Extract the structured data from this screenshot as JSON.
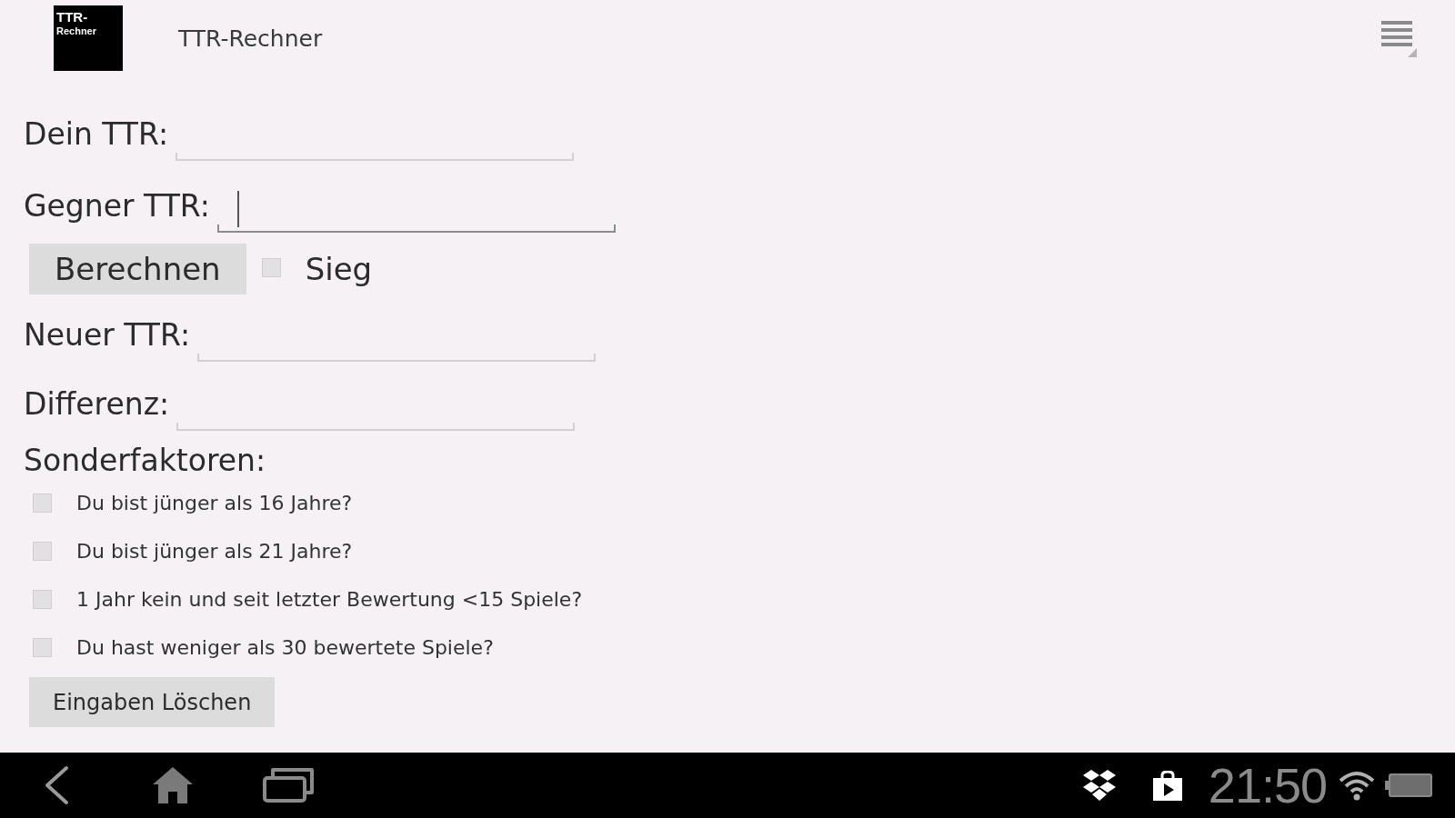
{
  "action_bar": {
    "logo_lines": [
      "TTR-",
      "Rechner"
    ],
    "title": "TTR-Rechner"
  },
  "inputs": [
    {
      "label": "Dein TTR:",
      "focused": false
    },
    {
      "label": "Gegner TTR:",
      "focused": true
    }
  ],
  "calculate": {
    "button": "Berechnen",
    "win": {
      "label": "Sieg",
      "checked": false
    }
  },
  "results": [
    {
      "label": "Neuer TTR:",
      "focused": false
    },
    {
      "label": "Differenz:",
      "focused": false
    }
  ],
  "special_factors": {
    "heading": "Sonderfaktoren:",
    "options": [
      {
        "label": "Du bist jünger als 16 Jahre?",
        "checked": false
      },
      {
        "label": "Du bist jünger als 21 Jahre?",
        "checked": false
      },
      {
        "label": "1 Jahr kein und seit letzter Bewertung <15 Spiele?",
        "checked": false
      },
      {
        "label": "Du hast weniger als 30 bewertete Spiele?",
        "checked": false
      }
    ]
  },
  "clear_button": "Eingaben Löschen",
  "navigation_bar": {
    "time": "21:50"
  }
}
